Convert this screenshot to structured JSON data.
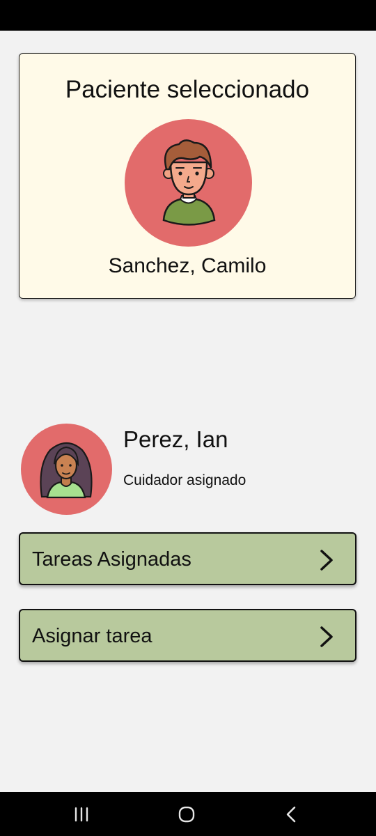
{
  "patient_card": {
    "title": "Paciente seleccionado",
    "patient_name": "Sanchez, Camilo",
    "avatar_icon": "boy-avatar-icon"
  },
  "caregiver": {
    "name": "Perez, Ian",
    "role": "Cuidador asignado",
    "avatar_icon": "woman-avatar-icon"
  },
  "actions": [
    {
      "label": "Tareas Asignadas",
      "icon": "chevron-right-icon"
    },
    {
      "label": "Asignar tarea",
      "icon": "chevron-right-icon"
    }
  ],
  "navigation": [
    {
      "icon": "recent-apps-icon"
    },
    {
      "icon": "home-icon"
    },
    {
      "icon": "back-icon"
    }
  ],
  "colors": {
    "card_background": "#fffae8",
    "avatar_background": "#e26b6b",
    "button_background": "#b8c99d",
    "page_background": "#f2f2f2"
  }
}
